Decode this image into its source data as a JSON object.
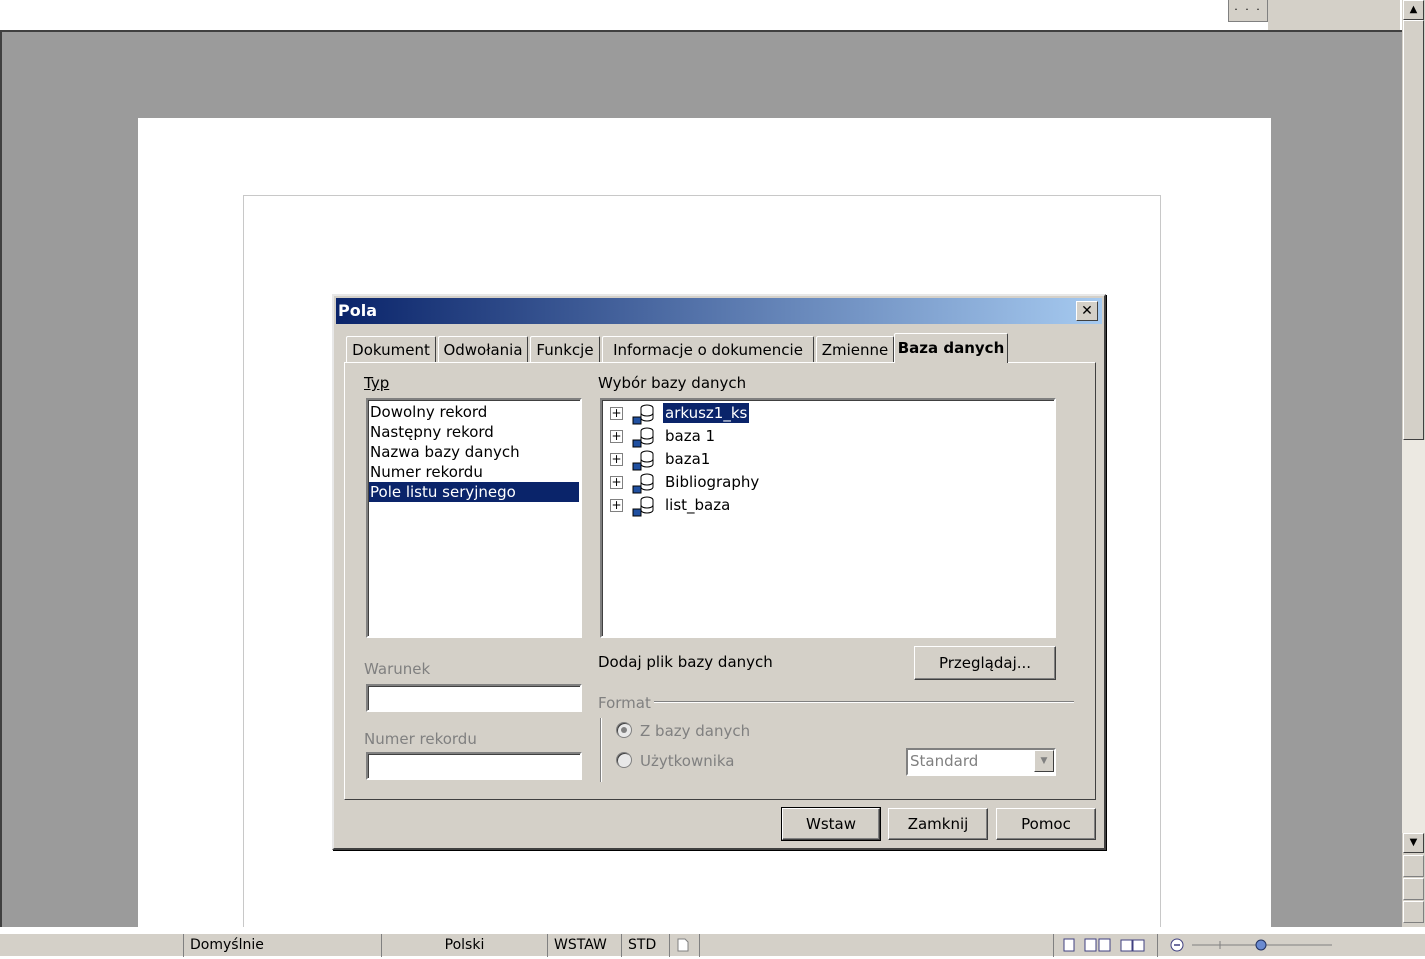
{
  "window": {
    "ruler_button": "· · ·"
  },
  "dialog": {
    "title": "Pola",
    "close_label": "✕",
    "tabs": [
      {
        "label": "Dokument"
      },
      {
        "label": "Odwołania"
      },
      {
        "label": "Funkcje"
      },
      {
        "label": "Informacje o dokumencie"
      },
      {
        "label": "Zmienne"
      },
      {
        "label": "Baza danych",
        "active": true
      }
    ],
    "typ": {
      "label": "Typ",
      "items": [
        "Dowolny rekord",
        "Następny rekord",
        "Nazwa bazy danych",
        "Numer rekordu",
        "Pole listu seryjnego"
      ],
      "selected_index": 4
    },
    "database_selection": {
      "label": "Wybór bazy danych",
      "items": [
        {
          "name": "arkusz1_ks",
          "selected": true
        },
        {
          "name": "baza 1"
        },
        {
          "name": "baza1"
        },
        {
          "name": "Bibliography"
        },
        {
          "name": "list_baza"
        }
      ],
      "expander_symbol": "+"
    },
    "add_db_label": "Dodaj plik bazy danych",
    "browse_button": "Przeglądaj...",
    "condition_label": "Warunek",
    "condition_value": "",
    "record_number_label": "Numer rekordu",
    "record_number_value": "",
    "format": {
      "label": "Format",
      "option_from_db": "Z bazy danych",
      "option_user": "Użytkownika",
      "selected": "from_db",
      "user_format_value": "Standard",
      "dropdown_arrow": "▼"
    },
    "buttons": {
      "insert": "Wstaw",
      "close": "Zamknij",
      "help": "Pomoc"
    }
  },
  "statusbar": {
    "page_style": "Domyślnie",
    "language": "Polski",
    "insert_mode": "WSTAW",
    "selection_mode": "STD"
  },
  "scrollbar": {
    "up_arrow": "▲",
    "down_arrow": "▼"
  },
  "colors": {
    "selection": "#0a246a",
    "dialog_bg": "#d4d0c8",
    "workspace": "#9b9b9b"
  }
}
